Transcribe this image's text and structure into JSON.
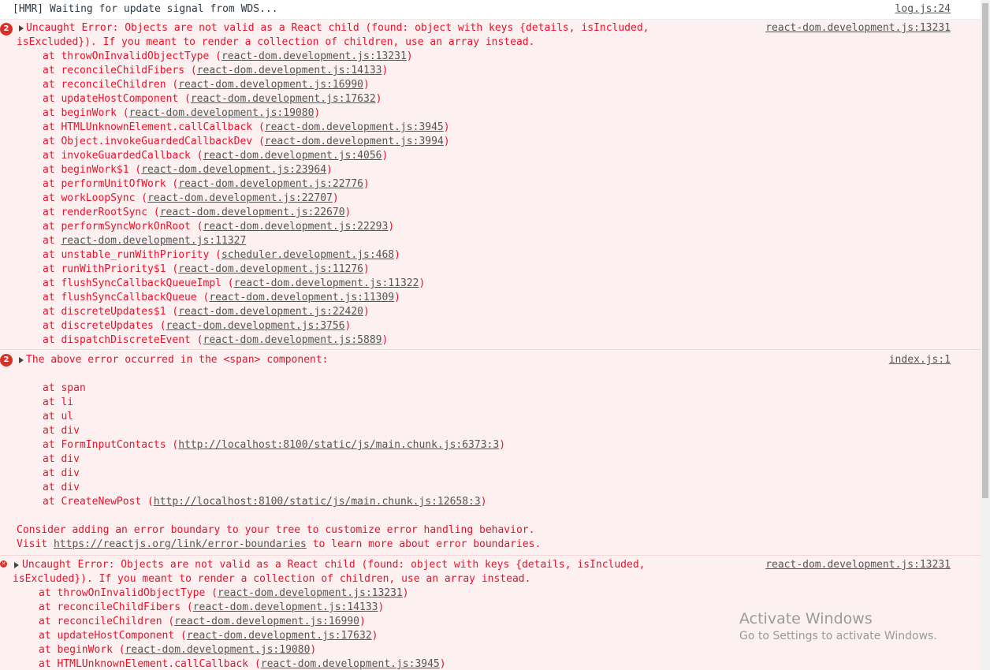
{
  "hmr": {
    "text": "[HMR] Waiting for update signal from WDS...",
    "source": "log.js:24"
  },
  "error1": {
    "count": "2",
    "line1": "Uncaught Error: Objects are not valid as a React child (found: object with keys {details, isIncluded,",
    "line2": "isExcluded}). If you meant to render a collection of children, use an array instead.",
    "source": "react-dom.development.js:13231",
    "frames": [
      {
        "fn": "throwOnInvalidObjectType",
        "loc": "react-dom.development.js:13231"
      },
      {
        "fn": "reconcileChildFibers",
        "loc": "react-dom.development.js:14133"
      },
      {
        "fn": "reconcileChildren",
        "loc": "react-dom.development.js:16990"
      },
      {
        "fn": "updateHostComponent",
        "loc": "react-dom.development.js:17632"
      },
      {
        "fn": "beginWork",
        "loc": "react-dom.development.js:19080"
      },
      {
        "fn": "HTMLUnknownElement.callCallback",
        "loc": "react-dom.development.js:3945"
      },
      {
        "fn": "Object.invokeGuardedCallbackDev",
        "loc": "react-dom.development.js:3994"
      },
      {
        "fn": "invokeGuardedCallback",
        "loc": "react-dom.development.js:4056"
      },
      {
        "fn": "beginWork$1",
        "loc": "react-dom.development.js:23964"
      },
      {
        "fn": "performUnitOfWork",
        "loc": "react-dom.development.js:22776"
      },
      {
        "fn": "workLoopSync",
        "loc": "react-dom.development.js:22707"
      },
      {
        "fn": "renderRootSync",
        "loc": "react-dom.development.js:22670"
      },
      {
        "fn": "performSyncWorkOnRoot",
        "loc": "react-dom.development.js:22293"
      },
      {
        "fn": "",
        "loc": "react-dom.development.js:11327"
      },
      {
        "fn": "unstable_runWithPriority",
        "loc": "scheduler.development.js:468"
      },
      {
        "fn": "runWithPriority$1",
        "loc": "react-dom.development.js:11276"
      },
      {
        "fn": "flushSyncCallbackQueueImpl",
        "loc": "react-dom.development.js:11322"
      },
      {
        "fn": "flushSyncCallbackQueue",
        "loc": "react-dom.development.js:11309"
      },
      {
        "fn": "discreteUpdates$1",
        "loc": "react-dom.development.js:22420"
      },
      {
        "fn": "discreteUpdates",
        "loc": "react-dom.development.js:3756"
      },
      {
        "fn": "dispatchDiscreteEvent",
        "loc": "react-dom.development.js:5889"
      }
    ]
  },
  "error2": {
    "count": "2",
    "line1": "The above error occurred in the <span> component:",
    "source": "index.js:1",
    "frames": [
      {
        "fn": "span",
        "loc": ""
      },
      {
        "fn": "li",
        "loc": ""
      },
      {
        "fn": "ul",
        "loc": ""
      },
      {
        "fn": "div",
        "loc": ""
      },
      {
        "fn": "FormInputContacts",
        "loc": "http://localhost:8100/static/js/main.chunk.js:6373:3"
      },
      {
        "fn": "div",
        "loc": ""
      },
      {
        "fn": "div",
        "loc": ""
      },
      {
        "fn": "div",
        "loc": ""
      },
      {
        "fn": "CreateNewPost",
        "loc": "http://localhost:8100/static/js/main.chunk.js:12658:3"
      }
    ],
    "footer1": "Consider adding an error boundary to your tree to customize error handling behavior.",
    "footer2_prefix": "Visit ",
    "footer2_link": "https://reactjs.org/link/error-boundaries",
    "footer2_suffix": " to learn more about error boundaries."
  },
  "error3": {
    "icon": "✕",
    "line1": "Uncaught Error: Objects are not valid as a React child (found: object with keys {details, isIncluded,",
    "line2": "isExcluded}). If you meant to render a collection of children, use an array instead.",
    "source": "react-dom.development.js:13231",
    "frames": [
      {
        "fn": "throwOnInvalidObjectType",
        "loc": "react-dom.development.js:13231"
      },
      {
        "fn": "reconcileChildFibers",
        "loc": "react-dom.development.js:14133"
      },
      {
        "fn": "reconcileChildren",
        "loc": "react-dom.development.js:16990"
      },
      {
        "fn": "updateHostComponent",
        "loc": "react-dom.development.js:17632"
      },
      {
        "fn": "beginWork",
        "loc": "react-dom.development.js:19080"
      },
      {
        "fn": "HTMLUnknownElement.callCallback",
        "loc": "react-dom.development.js:3945"
      }
    ]
  },
  "watermark": {
    "title": "Activate Windows",
    "subtitle": "Go to Settings to activate Windows."
  }
}
